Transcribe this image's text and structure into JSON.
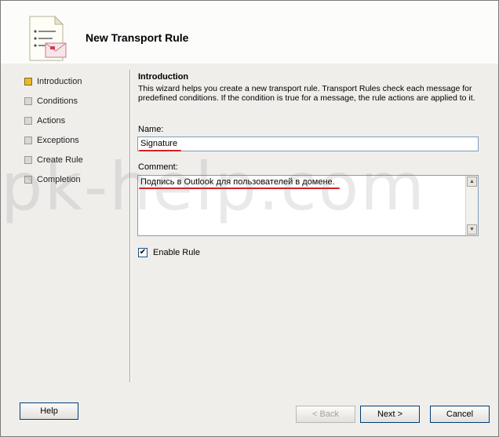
{
  "wizard": {
    "title": "New Transport Rule"
  },
  "steps": [
    {
      "label": "Introduction",
      "active": true
    },
    {
      "label": "Conditions",
      "active": false
    },
    {
      "label": "Actions",
      "active": false
    },
    {
      "label": "Exceptions",
      "active": false
    },
    {
      "label": "Create Rule",
      "active": false
    },
    {
      "label": "Completion",
      "active": false
    }
  ],
  "content": {
    "section_title": "Introduction",
    "description": "This wizard helps you create a new transport rule. Transport Rules check each message for predefined conditions. If the condition is true for a message, the rule actions are applied to it.",
    "name_label": "Name:",
    "name_value": "Signature",
    "comment_label": "Comment:",
    "comment_value": "Подпись в Outlook для пользователей в домене.",
    "enable_rule_label": "Enable Rule",
    "enable_rule_checked": true
  },
  "buttons": {
    "help": "Help",
    "back": "< Back",
    "next": "Next >",
    "cancel": "Cancel"
  },
  "watermark": "pk-help.com",
  "colors": {
    "active_step": "#e9b92e",
    "annotation": "#d41f26"
  }
}
